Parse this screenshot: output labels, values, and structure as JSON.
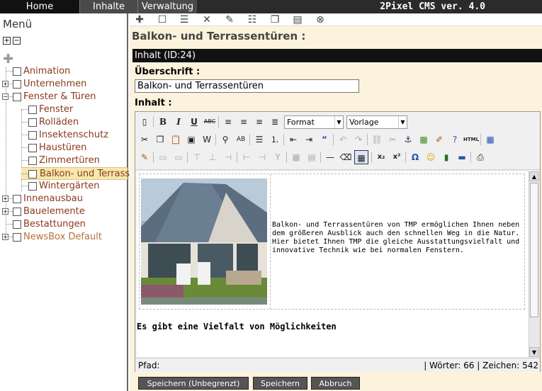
{
  "topnav": {
    "home": "Home",
    "inhalte": "Inhalte",
    "verwaltung": "Verwaltung"
  },
  "app_title": "2Pixel CMS ver. 4.0",
  "sidebar": {
    "title": "Menü",
    "items": [
      {
        "label": "Animation"
      },
      {
        "label": "Unternehmen"
      },
      {
        "label": "Fenster & Türen"
      },
      {
        "label": "Fenster"
      },
      {
        "label": "Rolläden"
      },
      {
        "label": "Insektenschutz"
      },
      {
        "label": "Haustüren"
      },
      {
        "label": "Zimmertüren"
      },
      {
        "label": "Balkon- und Terrass"
      },
      {
        "label": "Wintergärten"
      },
      {
        "label": "Innenausbau"
      },
      {
        "label": "Bauelemente"
      },
      {
        "label": "Bestattungen"
      },
      {
        "label": "NewsBox Default"
      }
    ]
  },
  "page": {
    "title": "Balkon- und Terrassentüren :",
    "content_header": "Inhalt (ID:24)",
    "heading_label": "Überschrift :",
    "heading_value": "Balkon- und Terrassentüren",
    "content_label": "Inhalt :"
  },
  "editor": {
    "format_select": "Format",
    "template_select": "Vorlage",
    "body_text": "Balkon- und Terrassentüren von TMP ermöglichen Ihnen neben dem größeren Ausblick auch den schnellen Weg in die Natur. Hier bietet Ihnen TMP die gleiche Ausstattungsvielfalt und innovative Technik wie bei normalen Fenstern.",
    "subheading": "Es gibt eine Vielfalt von Möglichkeiten",
    "path_label": "Pfad:",
    "word_count": "| Wörter: 66 | Zeichen: 542"
  },
  "buttons": {
    "save_unlimited": "Speichern (Unbegrenzt)",
    "save": "Speichern",
    "cancel": "Abbruch"
  }
}
